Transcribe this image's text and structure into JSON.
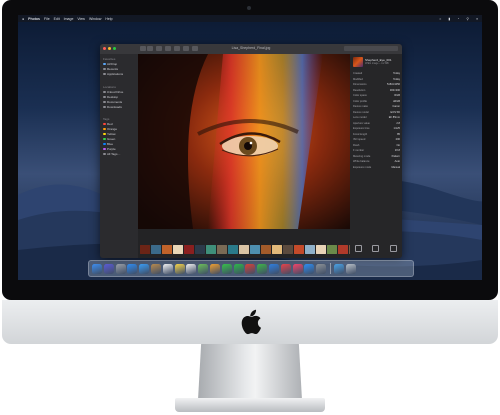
{
  "menubar": {
    "apple": "",
    "app_name": "Photos",
    "menus": [
      "File",
      "Edit",
      "Image",
      "View",
      "Window",
      "Help"
    ],
    "status_icons": [
      "wifi-icon",
      "battery-icon",
      "clock-icon",
      "search-icon",
      "list-icon"
    ]
  },
  "window": {
    "title": "Lisa_Shepherd_Final.jpg",
    "toolbar_buttons": [
      "back",
      "forward",
      "view",
      "zoom",
      "rotate",
      "share",
      "favorite"
    ],
    "search_placeholder": "Search"
  },
  "sidebar": {
    "sections": [
      {
        "heading": "Favorites",
        "items": [
          "AirDrop",
          "Recents",
          "Applications"
        ]
      },
      {
        "heading": "Locations",
        "items": [
          "iCloud Drive",
          "Desktop",
          "Documents",
          "Downloads"
        ]
      },
      {
        "heading": "Tags",
        "items": [
          "Red",
          "Orange",
          "Yellow",
          "Green",
          "Blue",
          "Purple",
          "All Tags…"
        ]
      }
    ]
  },
  "inspector": {
    "file_name": "Shepherd_Eye_001",
    "file_info": "JPEG image – 4.2 MB",
    "rows": [
      {
        "label": "Created",
        "value": "Today"
      },
      {
        "label": "Modified",
        "value": "Today"
      },
      {
        "label": "Dimensions",
        "value": "5184×3456"
      },
      {
        "label": "Resolution",
        "value": "300×300"
      },
      {
        "label": "Color space",
        "value": "RGB"
      },
      {
        "label": "Color profile",
        "value": "sRGB"
      },
      {
        "label": "Device make",
        "value": "Canon"
      },
      {
        "label": "Device model",
        "value": "EOS 5D"
      },
      {
        "label": "Lens model",
        "value": "EF 85mm"
      },
      {
        "label": "Aperture value",
        "value": "2.8"
      },
      {
        "label": "Exposure time",
        "value": "1/125"
      },
      {
        "label": "Focal length",
        "value": "85"
      },
      {
        "label": "ISO speed",
        "value": "200"
      },
      {
        "label": "Flash",
        "value": "No"
      },
      {
        "label": "F number",
        "value": "f/2.8"
      },
      {
        "label": "Metering mode",
        "value": "Pattern"
      },
      {
        "label": "White balance",
        "value": "Auto"
      },
      {
        "label": "Exposure mode",
        "value": "Manual"
      }
    ],
    "tools": [
      "rotate-icon",
      "markup-icon",
      "more-icon"
    ]
  },
  "filmstrip": {
    "count": 22,
    "selected_index": 21,
    "colors": [
      "#6b2416",
      "#3b6a8a",
      "#c0622a",
      "#e8d6b8",
      "#8a1f1f",
      "#2c3a4a",
      "#3f8f7a",
      "#7a6a55",
      "#2a7a8a",
      "#d9c3a4",
      "#4e8fb0",
      "#a35b2a",
      "#e2b97a",
      "#5b4a3e",
      "#c44a2a",
      "#8fb0c9",
      "#e7d2b6",
      "#6a8a4a",
      "#b03a2a",
      "#7b5f47",
      "#d0a070",
      "#c2461e"
    ]
  },
  "dock": {
    "icons": [
      {
        "name": "finder-icon",
        "color": "#3d8ef0"
      },
      {
        "name": "siri-icon",
        "color": "#5b5bd6"
      },
      {
        "name": "launchpad-icon",
        "color": "#9aa0a8"
      },
      {
        "name": "safari-icon",
        "color": "#2f8cf2"
      },
      {
        "name": "mail-icon",
        "color": "#3a9df5"
      },
      {
        "name": "contacts-icon",
        "color": "#b98b4e"
      },
      {
        "name": "calendar-icon",
        "color": "#f4f4f4"
      },
      {
        "name": "notes-icon",
        "color": "#f7d54a"
      },
      {
        "name": "reminders-icon",
        "color": "#f2f2f2"
      },
      {
        "name": "maps-icon",
        "color": "#6cbf5a"
      },
      {
        "name": "photos-icon",
        "color": "#f0a030"
      },
      {
        "name": "messages-icon",
        "color": "#37c24a"
      },
      {
        "name": "facetime-icon",
        "color": "#2eb84a"
      },
      {
        "name": "photo-booth-icon",
        "color": "#d8423a"
      },
      {
        "name": "numbers-icon",
        "color": "#3fb54a"
      },
      {
        "name": "keynote-icon",
        "color": "#2f7fe0"
      },
      {
        "name": "news-icon",
        "color": "#e9424a"
      },
      {
        "name": "music-icon",
        "color": "#f2456a"
      },
      {
        "name": "app-store-icon",
        "color": "#2d8ef5"
      },
      {
        "name": "system-preferences-icon",
        "color": "#8d9399"
      },
      {
        "name": "downloads-folder-icon",
        "color": "#4aa3e8"
      },
      {
        "name": "trash-icon",
        "color": "#b9c0c8"
      }
    ]
  },
  "colors": {
    "bezel": "#0b0b0d",
    "window_bg": "#232325",
    "sidebar_bg": "#2b2b2e",
    "accent": "#0a84ff"
  }
}
